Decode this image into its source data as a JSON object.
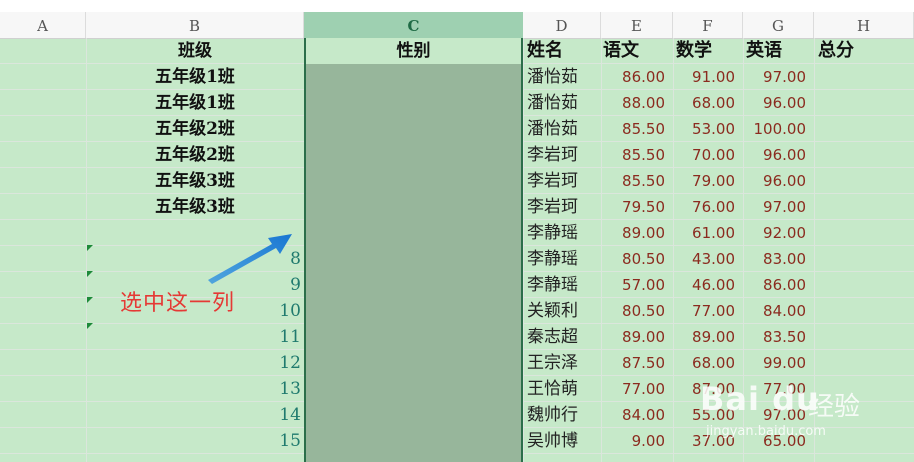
{
  "spreadsheet": {
    "column_headers": [
      "A",
      "B",
      "C",
      "D",
      "E",
      "F",
      "G",
      "H"
    ],
    "selected_column": "C",
    "header_row": {
      "B": "班级",
      "C": "性别",
      "D": "姓名",
      "E": "语文",
      "F": "数学",
      "G": "英语",
      "H": "总分"
    },
    "rows": [
      {
        "B": "五年级1班",
        "D": "潘怡茹",
        "E": "86.00",
        "F": "91.00",
        "G": "97.00"
      },
      {
        "B": "五年级1班",
        "D": "潘怡茹",
        "E": "88.00",
        "F": "68.00",
        "G": "96.00"
      },
      {
        "B": "五年级2班",
        "D": "潘怡茹",
        "E": "85.50",
        "F": "53.00",
        "G": "100.00"
      },
      {
        "B": "五年级2班",
        "D": "李岩珂",
        "E": "85.50",
        "F": "70.00",
        "G": "96.00"
      },
      {
        "B": "五年级3班",
        "D": "李岩珂",
        "E": "85.50",
        "F": "79.00",
        "G": "96.00"
      },
      {
        "B": "五年级3班",
        "D": "李岩珂",
        "E": "79.50",
        "F": "76.00",
        "G": "97.00"
      },
      {
        "B": "",
        "D": "李静瑶",
        "E": "89.00",
        "F": "61.00",
        "G": "92.00"
      },
      {
        "B": "8",
        "D": "李静瑶",
        "E": "80.50",
        "F": "43.00",
        "G": "83.00"
      },
      {
        "B": "9",
        "D": "李静瑶",
        "E": "57.00",
        "F": "46.00",
        "G": "86.00"
      },
      {
        "B": "10",
        "D": "关颖利",
        "E": "80.50",
        "F": "77.00",
        "G": "84.00"
      },
      {
        "B": "11",
        "D": "秦志超",
        "E": "89.00",
        "F": "89.00",
        "G": "83.50"
      },
      {
        "B": "12",
        "D": "王宗泽",
        "E": "87.50",
        "F": "68.00",
        "G": "99.00"
      },
      {
        "B": "13",
        "D": "王恰萌",
        "E": "77.00",
        "F": "87.00",
        "G": "77.00"
      },
      {
        "B": "14",
        "D": "魏帅行",
        "E": "84.00",
        "F": "55.00",
        "G": "97.00"
      },
      {
        "B": "15",
        "D": "吴帅博",
        "E": "9.00",
        "F": "37.00",
        "G": "65.00"
      }
    ]
  },
  "annotation": {
    "text": "选中这一列"
  },
  "watermark": {
    "logo": "Bai du",
    "brand": "经验",
    "url": "jingyan.baidu.com"
  },
  "colors": {
    "sheet_bg": "#c6e9c9",
    "selected_column_fill": "#97b69b",
    "annotation_red": "#e53935",
    "score_text": "#8b2b1f"
  }
}
